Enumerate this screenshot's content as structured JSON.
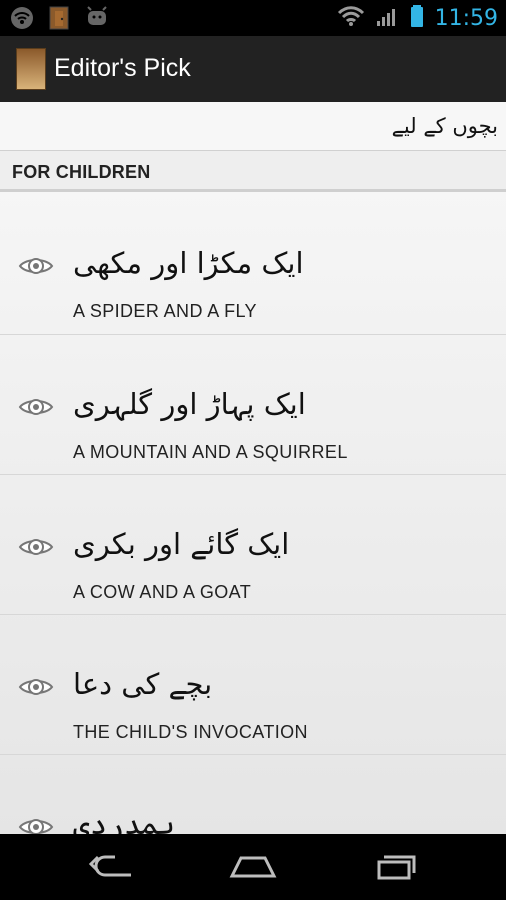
{
  "status_bar": {
    "time": "11:59",
    "icons": [
      "wifi-icon",
      "door-icon",
      "android-icon",
      "wifi-signal-icon",
      "signal-bars-icon",
      "battery-icon"
    ]
  },
  "action_bar": {
    "title": "Editor's Pick",
    "app_icon": "app-icon"
  },
  "content": {
    "header_urdu": "بچوں کے لیے",
    "section_title": "FOR CHILDREN",
    "items": [
      {
        "urdu": "ایک مکڑا اور مکھی",
        "english": "A SPIDER AND A FLY"
      },
      {
        "urdu": "ایک پہاڑ اور گلہری",
        "english": "A MOUNTAIN AND A SQUIRREL"
      },
      {
        "urdu": "ایک گائے اور بکری",
        "english": "A COW AND A GOAT"
      },
      {
        "urdu": "بچے کی دعا",
        "english": "THE CHILD'S INVOCATION"
      },
      {
        "urdu": "ہمدردی",
        "english": ""
      }
    ]
  },
  "navigation": {
    "buttons": [
      "back-icon",
      "home-icon",
      "recent-apps-icon"
    ]
  },
  "colors": {
    "status_accent": "#33b5e5",
    "action_bar": "#222222",
    "content_bg": "#efefef",
    "nav_bar": "#000000"
  }
}
